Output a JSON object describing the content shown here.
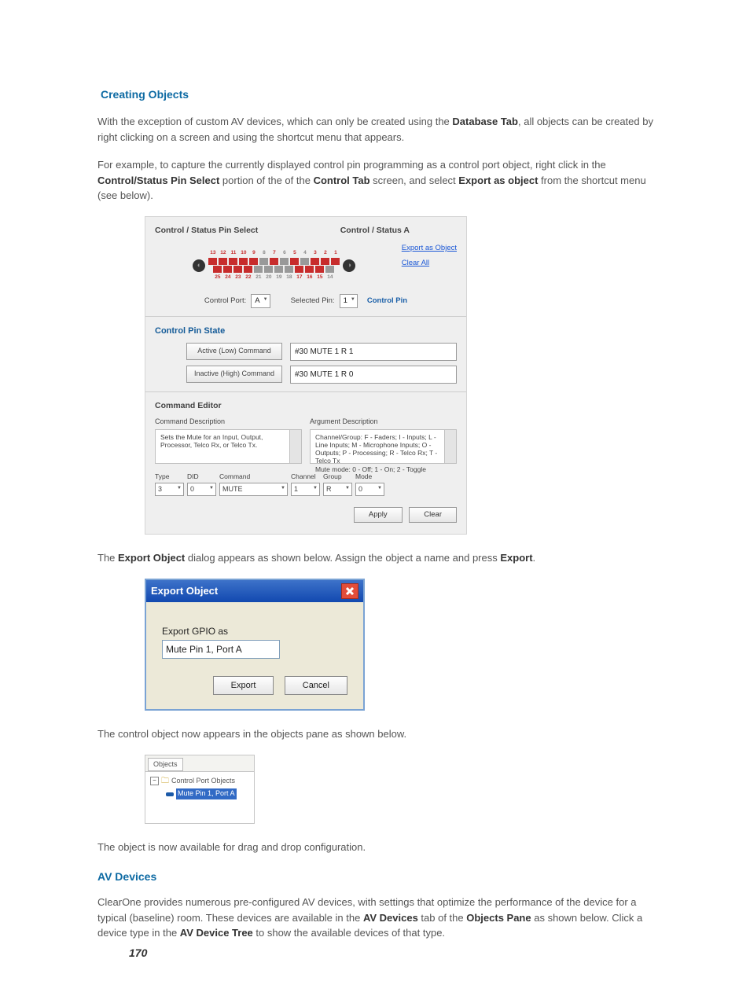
{
  "headings": {
    "creating_objects": "Creating Objects",
    "av_devices": "AV Devices"
  },
  "para1": {
    "pre": "With the exception of custom AV devices, which can only be created using the ",
    "b1": "Database Tab",
    "post": ", all objects can be created by right clicking on a screen and using the shortcut menu that appears."
  },
  "para2": {
    "pre": "For example, to capture the currently displayed control pin programming as a control port object, right click in the ",
    "b1": "Control/Status Pin Select",
    "mid1": " portion of the of the ",
    "b2": "Control Tab",
    "mid2": " screen, and select ",
    "b3": "Export as object",
    "post": " from the shortcut menu (see below)."
  },
  "fig1": {
    "title_left": "Control / Status Pin Select",
    "title_right": "Control / Status A",
    "top_nums": [
      "13",
      "12",
      "11",
      "10",
      "9",
      "8",
      "7",
      "6",
      "5",
      "4",
      "3",
      "2",
      "1"
    ],
    "bottom_nums": [
      "25",
      "24",
      "23",
      "22",
      "21",
      "20",
      "19",
      "18",
      "17",
      "16",
      "15",
      "14"
    ],
    "link_export": "Export as Object",
    "link_clear": "Clear All",
    "control_port_lbl": "Control Port:",
    "control_port_val": "A",
    "selected_pin_lbl": "Selected Pin:",
    "selected_pin_val": "1",
    "control_pin_lbl": "Control Pin",
    "state_title": "Control Pin State",
    "active_btn": "Active (Low) Command",
    "active_val": "#30 MUTE 1 R 1",
    "inactive_btn": "Inactive (High) Command",
    "inactive_val": "#30 MUTE 1 R 0",
    "editor_title": "Command Editor",
    "cmd_desc_lbl": "Command Description",
    "arg_desc_lbl": "Argument Description",
    "cmd_desc_txt": "Sets the Mute for an Input, Output, Processor, Telco Rx, or Telco Tx.",
    "arg_desc_txt": "Channel/Group: F - Faders; I - Inputs; L - Line Inputs; M - Microphone Inputs; O - Outputs; P - Processing; R - Telco Rx; T - Telco Tx\nMute mode: 0 - Off; 1 - On; 2 - Toggle",
    "row": {
      "type_lbl": "Type",
      "type": "3",
      "did_lbl": "DID",
      "did": "0",
      "command_lbl": "Command",
      "command": "MUTE",
      "channel_lbl": "Channel",
      "channel": "1",
      "group_lbl": "Group",
      "group": "R",
      "mode_lbl": "Mode",
      "mode": "0"
    },
    "apply": "Apply",
    "clear": "Clear"
  },
  "para3": {
    "pre": "The ",
    "b1": "Export Object",
    "mid": " dialog appears as shown below. Assign the object a name and press ",
    "b2": "Export",
    "post": "."
  },
  "dialog": {
    "title": "Export Object",
    "label": "Export GPIO as",
    "value": "Mute Pin 1, Port A",
    "export": "Export",
    "cancel": "Cancel"
  },
  "para4": "The control object now appears in the objects pane as shown below.",
  "objects_pane": {
    "tab": "Objects",
    "folder": "Control Port Objects",
    "item": "Mute Pin 1, Port A"
  },
  "para5": "The object is now available for drag and drop configuration.",
  "para6": {
    "pre": "ClearOne provides numerous pre-configured AV devices, with settings that optimize the performance of the device for a typical (baseline) room. These devices are available in the ",
    "b1": "AV Devices",
    "mid1": " tab of the ",
    "b2": "Objects Pane",
    "mid2": " as shown below. Click a device type in the ",
    "b3": "AV Device Tree",
    "post": " to show the available devices of that type."
  },
  "page_number": "170"
}
